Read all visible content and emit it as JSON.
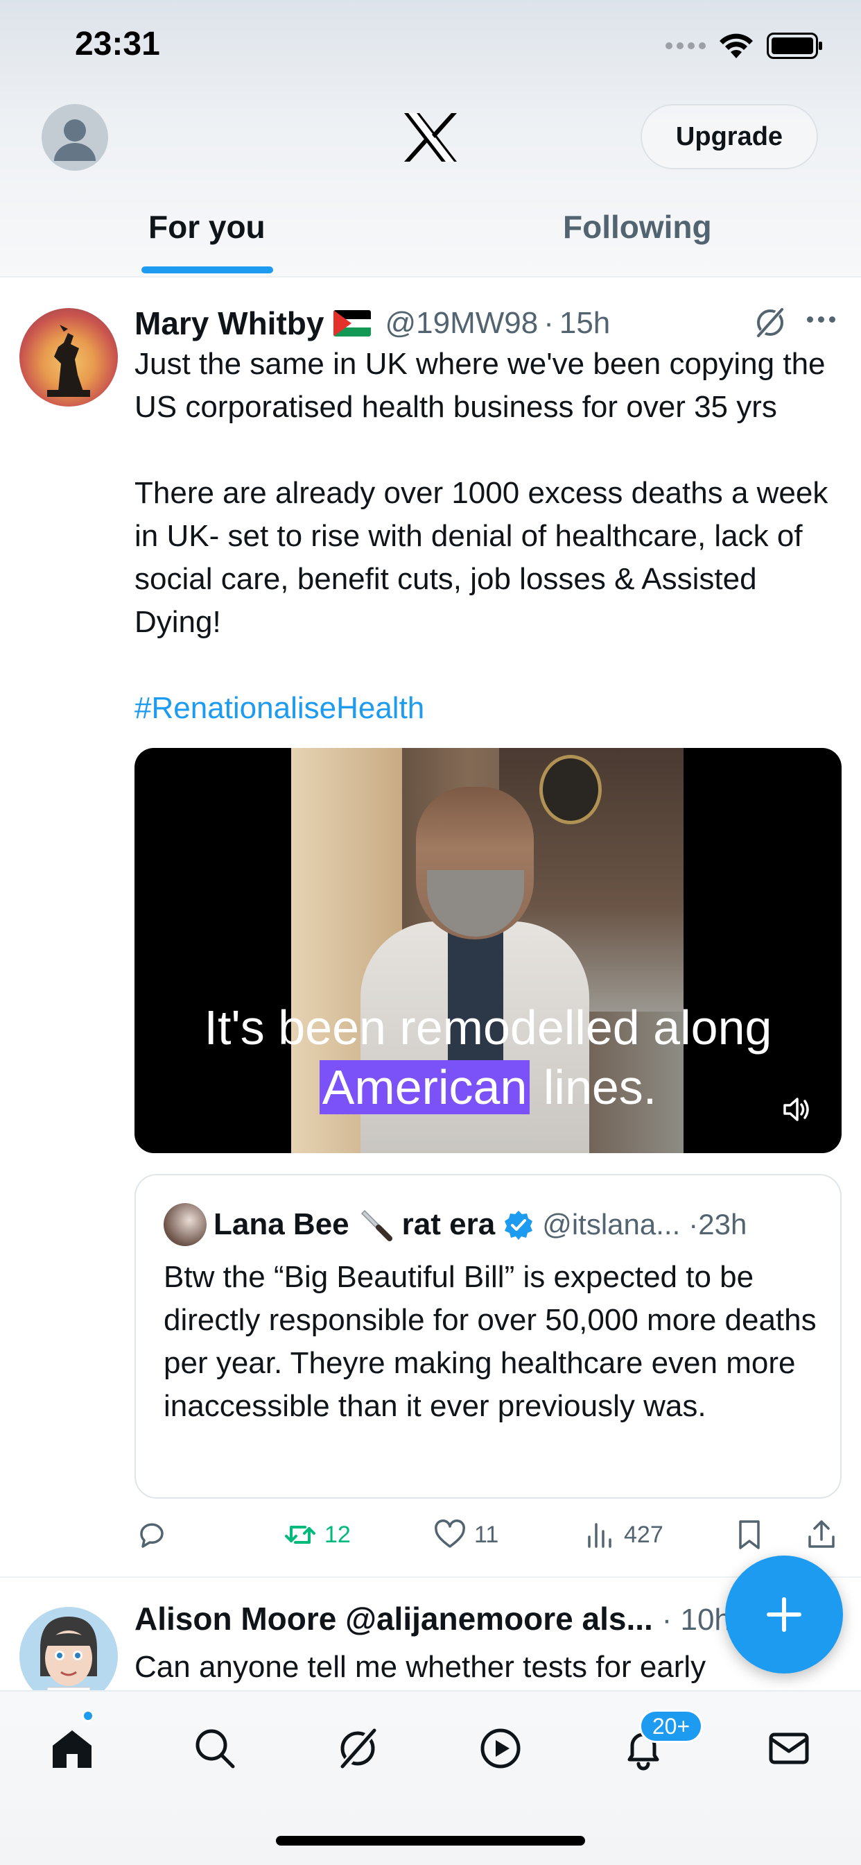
{
  "status_bar": {
    "time": "23:31"
  },
  "header": {
    "upgrade_label": "Upgrade",
    "tabs": [
      {
        "label": "For you",
        "active": true
      },
      {
        "label": "Following",
        "active": false
      }
    ]
  },
  "tweet": {
    "author_name": "Mary Whitby",
    "handle": "@19MW98",
    "separator": "·",
    "time": "15h",
    "text": "Just the same in UK where we've been copying the US corporatised health business for over 35 yrs\n\nThere are already over 1000 excess deaths a week in UK- set to rise with denial of healthcare, lack of social care, benefit cuts, job losses & Assisted Dying!",
    "hashtag": "#RenationaliseHealth",
    "video_caption": {
      "line1": "It's been remodelled along",
      "highlighted": "American",
      "line2_rest": " lines."
    },
    "quote": {
      "author_name": "Lana Bee",
      "author_name_suffix": "rat era",
      "handle": "@itslana...",
      "separator": "·",
      "time": "23h",
      "text": "Btw the “Big Beautiful Bill” is expected to be directly responsible for over 50,000 more deaths per year. Theyre making healthcare even more inaccessible than it ever previously was."
    },
    "actions": {
      "reposts": "12",
      "likes": "11",
      "views": "427"
    }
  },
  "next_tweet": {
    "author": "Alison Moore @alijanemoore als...",
    "time": "· 10h",
    "text": "Can anyone tell me whether tests for early"
  },
  "bottom_nav": {
    "notifications_badge": "20+"
  },
  "colors": {
    "accent": "#1d9bf0",
    "repost_active": "#00ba7c",
    "secondary_text": "#536471",
    "caption_highlight": "#7b52f7"
  },
  "icons": [
    "profile-avatar",
    "x-logo",
    "grok-icon",
    "more-icon",
    "volume-icon",
    "verified-icon",
    "reply-icon",
    "repost-icon",
    "like-icon",
    "views-icon",
    "bookmark-icon",
    "share-icon",
    "compose-plus-icon",
    "home-icon",
    "search-icon",
    "grok-nav-icon",
    "video-icon",
    "bell-icon",
    "mail-icon"
  ]
}
